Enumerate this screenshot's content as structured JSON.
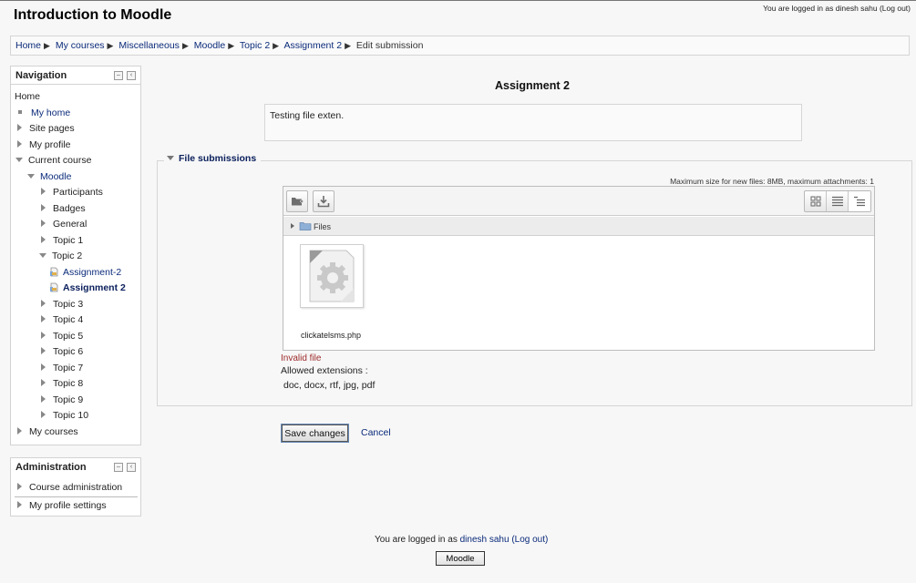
{
  "header": {
    "site_title": "Introduction to Moodle",
    "login_prefix": "You are logged in as",
    "user_name": "dinesh sahu",
    "logout": "(Log out)"
  },
  "breadcrumb": {
    "items": [
      "Home",
      "My courses",
      "Miscellaneous",
      "Moodle",
      "Topic 2",
      "Assignment 2",
      "Edit submission"
    ]
  },
  "navigation": {
    "title": "Navigation",
    "home": "Home",
    "my_home": "My home",
    "site_pages": "Site pages",
    "my_profile": "My profile",
    "current_course": "Current course",
    "course": "Moodle",
    "participants": "Participants",
    "badges": "Badges",
    "general": "General",
    "topic1": "Topic 1",
    "topic2": "Topic 2",
    "assignment_dash2": "Assignment-2",
    "assignment2": "Assignment 2",
    "topic3": "Topic 3",
    "topic4": "Topic 4",
    "topic5": "Topic 5",
    "topic6": "Topic 6",
    "topic7": "Topic 7",
    "topic8": "Topic 8",
    "topic9": "Topic 9",
    "topic10": "Topic 10",
    "my_courses": "My courses"
  },
  "administration": {
    "title": "Administration",
    "course_admin": "Course administration",
    "profile_settings": "My profile settings"
  },
  "main": {
    "title": "Assignment 2",
    "intro": "Testing file exten.",
    "section_legend": "File submissions",
    "max_size": "Maximum size for new files: 8MB, maximum attachments: 1",
    "path_label": "Files",
    "file_name": "clickatelsms.php",
    "error": "Invalid file",
    "allowed_label": "Allowed extensions :",
    "allowed_list": "doc, docx, rtf, jpg, pdf",
    "save_label": "Save changes",
    "cancel_label": "Cancel"
  },
  "footer": {
    "login_prefix": "You are logged in as",
    "user_name": "dinesh sahu",
    "logout": "(Log out)",
    "button_label": "Moodle"
  },
  "colors": {
    "link": "#0a2a7a",
    "error": "#9d2a2a",
    "background": "#f7f7f7"
  }
}
